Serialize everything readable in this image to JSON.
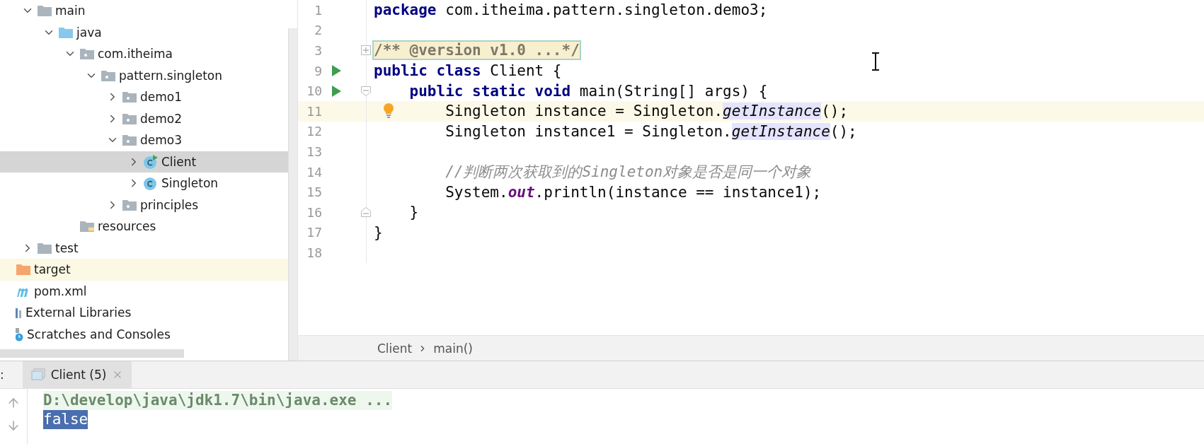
{
  "project_tree": {
    "nested_rows": [
      {
        "label": "main",
        "kind": "folder",
        "expanded": true,
        "selected": false,
        "highlighted": false,
        "children": [
          {
            "label": "java",
            "kind": "source-folder",
            "expanded": true,
            "selected": false,
            "highlighted": false,
            "children": [
              {
                "label": "com.itheima",
                "kind": "package",
                "expanded": true,
                "selected": false,
                "highlighted": false,
                "children": [
                  {
                    "label": "pattern.singleton",
                    "kind": "package",
                    "expanded": true,
                    "selected": false,
                    "highlighted": false,
                    "children": [
                      {
                        "label": "demo1",
                        "kind": "package",
                        "expanded": false,
                        "selected": false,
                        "highlighted": false
                      },
                      {
                        "label": "demo2",
                        "kind": "package",
                        "expanded": false,
                        "selected": false,
                        "highlighted": false
                      },
                      {
                        "label": "demo3",
                        "kind": "package",
                        "expanded": true,
                        "selected": false,
                        "highlighted": false,
                        "children": [
                          {
                            "label": "Client",
                            "kind": "run-class",
                            "expanded": false,
                            "selected": true,
                            "highlighted": false
                          },
                          {
                            "label": "Singleton",
                            "kind": "class",
                            "expanded": false,
                            "selected": false,
                            "highlighted": false
                          }
                        ]
                      },
                      {
                        "label": "principles",
                        "kind": "package",
                        "expanded": false,
                        "selected": false,
                        "highlighted": false
                      }
                    ]
                  }
                ]
              },
              {
                "label": "resources",
                "kind": "resources",
                "selected": false,
                "highlighted": false
              }
            ]
          }
        ]
      },
      {
        "label": "test",
        "kind": "folder",
        "expanded": false,
        "selected": false,
        "highlighted": false
      }
    ],
    "items": [
      {
        "label": "target",
        "kind": "excluded-folder",
        "selected": false,
        "highlighted": true
      },
      {
        "label": "pom.xml",
        "kind": "maven",
        "selected": false,
        "highlighted": false
      },
      {
        "label": "External Libraries",
        "kind": "libraries",
        "selected": false,
        "highlighted": false
      },
      {
        "label": "Scratches and Consoles",
        "kind": "scratches",
        "selected": false,
        "highlighted": false
      }
    ]
  },
  "editor": {
    "lines": [
      {
        "number": "1",
        "kind": "plain",
        "run": false,
        "current": false,
        "tokens": [
          {
            "text": "package",
            "kind": "keyword"
          },
          {
            "text": " com.itheima.pattern.singleton.demo3;",
            "kind": "text"
          }
        ]
      },
      {
        "number": "2",
        "kind": "plain",
        "run": false,
        "current": false
      },
      {
        "number": "3",
        "kind": "folded",
        "run": false,
        "current": false,
        "tokens": [
          {
            "text": "/** @version v1.0 ...*/",
            "kind": "folded"
          }
        ]
      },
      {
        "number": "9",
        "kind": "plain",
        "run": true,
        "current": false,
        "tokens": [
          {
            "text": "public class",
            "kind": "keyword"
          },
          {
            "text": " Client {",
            "kind": "text"
          }
        ]
      },
      {
        "number": "10",
        "kind": "fold-start",
        "run": true,
        "current": false,
        "tokens": [
          {
            "text": "    public static void",
            "kind": "keyword"
          },
          {
            "text": " main(String[] args) {",
            "kind": "text"
          }
        ]
      },
      {
        "number": "11",
        "kind": "plain",
        "run": false,
        "current": true,
        "bulb": true,
        "tokens": [
          {
            "text": "        Singleton instance = Singleton.",
            "kind": "text"
          },
          {
            "text": "getInstance",
            "kind": "method",
            "highlighted": true
          },
          {
            "text": "();",
            "kind": "text"
          }
        ]
      },
      {
        "number": "12",
        "kind": "plain",
        "run": false,
        "current": false,
        "tokens": [
          {
            "text": "        Singleton instance1 = Singleton.",
            "kind": "text"
          },
          {
            "text": "getInstance",
            "kind": "method",
            "highlighted": true
          },
          {
            "text": "();",
            "kind": "text"
          }
        ]
      },
      {
        "number": "13",
        "kind": "plain",
        "run": false,
        "current": false
      },
      {
        "number": "14",
        "kind": "plain",
        "run": false,
        "current": false,
        "tokens": [
          {
            "text": "        //判断两次获取到的Singleton对象是否是同一个对象",
            "kind": "comment"
          }
        ]
      },
      {
        "number": "15",
        "kind": "plain",
        "run": false,
        "current": false,
        "tokens": [
          {
            "text": "        System.",
            "kind": "text"
          },
          {
            "text": "out",
            "kind": "field"
          },
          {
            "text": ".println(instance == instance1);",
            "kind": "text"
          }
        ]
      },
      {
        "number": "16",
        "kind": "fold-end",
        "run": false,
        "current": false,
        "tokens": [
          {
            "text": "    }",
            "kind": "text"
          }
        ]
      },
      {
        "number": "17",
        "kind": "plain",
        "run": false,
        "current": false,
        "tokens": [
          {
            "text": "}",
            "kind": "text"
          }
        ]
      },
      {
        "number": "18",
        "kind": "plain",
        "run": false,
        "current": false
      }
    ],
    "breadcrumb": [
      "Client",
      "main()"
    ]
  },
  "run_panel": {
    "title_fragment": ":",
    "tabs": [
      {
        "label": "Client (5)",
        "selected": true
      }
    ],
    "console": [
      {
        "text": "D:\\develop\\java\\jdk1.7\\bin\\java.exe ...",
        "kind": "command",
        "selected": false
      },
      {
        "text": "false",
        "kind": "output",
        "selected": true
      }
    ]
  }
}
